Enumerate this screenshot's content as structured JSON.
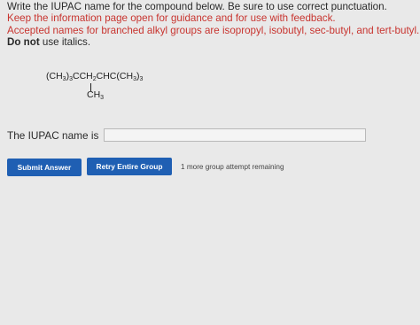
{
  "instructions": {
    "line1": "Write the IUPAC name for the compound below. Be sure to use correct punctuation.",
    "line2": "Keep the information page open for guidance and for use with feedback.",
    "line3": "Accepted names for branched alkyl groups are isopropyl, isobutyl, sec-butyl, and tert-butyl.",
    "line4_bold": "Do not",
    "line4_rest": " use italics."
  },
  "formula": {
    "p1": "(CH",
    "s1": "3",
    "p2": ")",
    "s2": "3",
    "p3": "CCH",
    "s3": "2",
    "p4": "CHC(CH",
    "s4": "3",
    "p5": ")",
    "s5": "3",
    "branch_text": "CH",
    "branch_sub": "3"
  },
  "answer": {
    "label": "The IUPAC name is",
    "value": ""
  },
  "buttons": {
    "submit": "Submit Answer",
    "retry": "Retry Entire Group"
  },
  "status": {
    "attempts": "1 more group attempt remaining"
  }
}
